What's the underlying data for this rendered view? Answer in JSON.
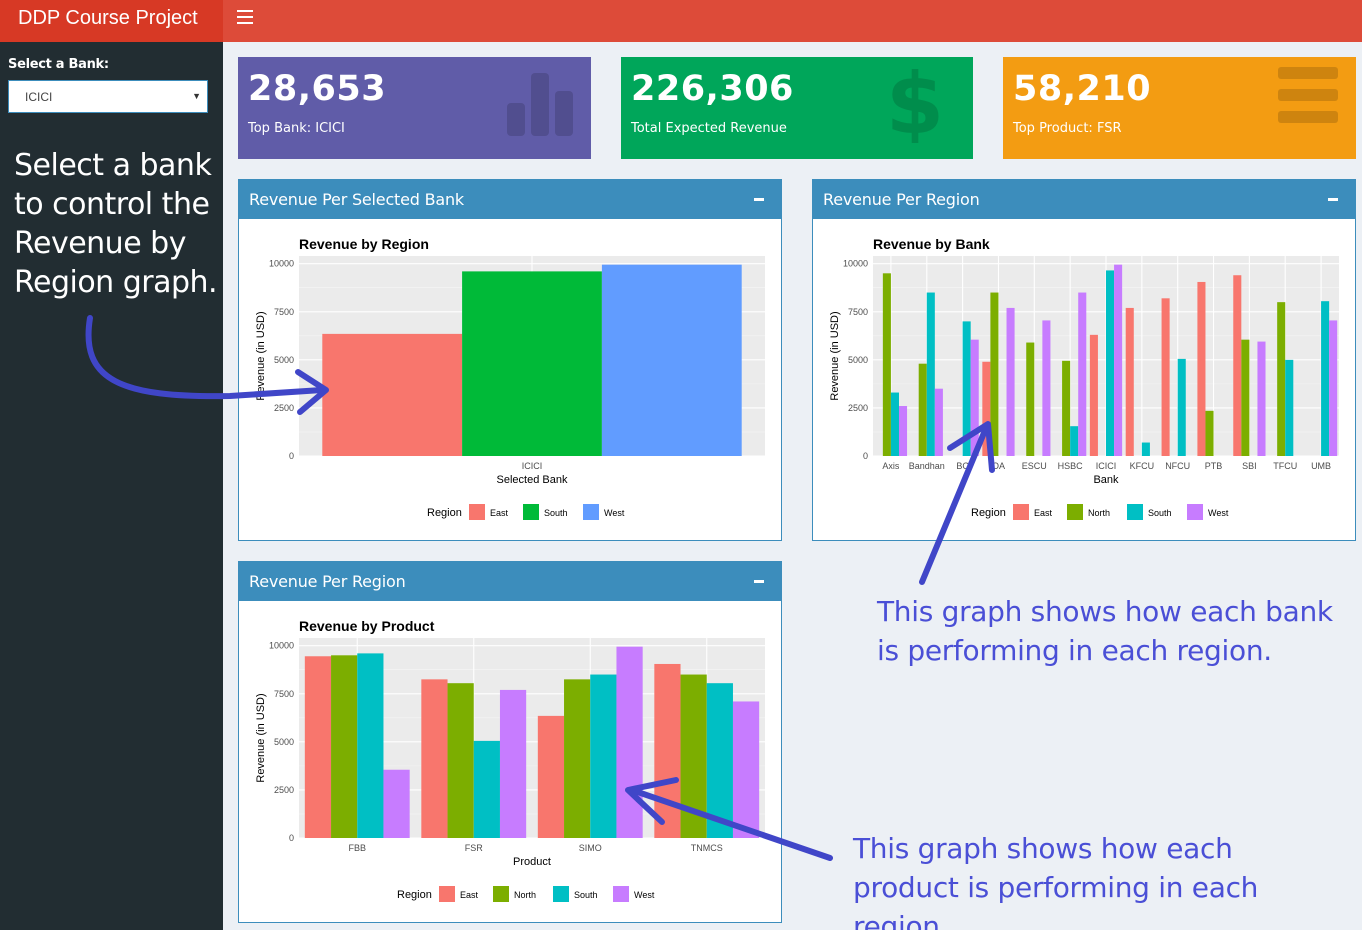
{
  "header": {
    "app_title": "DDP Course Project",
    "menu_icon": "hamburger-icon"
  },
  "sidebar": {
    "select_label": "Select a Bank:",
    "selected_bank": "ICICI",
    "note": "Select a bank to control the Revenue by Region graph."
  },
  "value_boxes": [
    {
      "value": "28,653",
      "label": "Top Bank: ICICI",
      "icon": "bar-chart-icon",
      "color": "#605ca8"
    },
    {
      "value": "226,306",
      "label": "Total Expected Revenue",
      "icon": "dollar-icon",
      "color": "#00a65a"
    },
    {
      "value": "58,210",
      "label": "Top Product: FSR",
      "icon": "list-icon",
      "color": "#f39c12"
    }
  ],
  "boxes": {
    "selected_bank": {
      "title": "Revenue Per Selected Bank"
    },
    "per_region": {
      "title": "Revenue Per Region"
    },
    "per_product": {
      "title": "Revenue Per Region"
    }
  },
  "annotations": {
    "bank_graph": "This graph shows how each bank is performing in each region.",
    "product_graph": "This graph shows how each product is performing in each region."
  },
  "colors": {
    "East": "#f8766d",
    "North": "#7cae00",
    "South": "#00bfc4",
    "West": "#c77cff",
    "East3": "#f8766d",
    "South3": "#00ba38",
    "West3": "#619cff",
    "annotation": "#4a4fd6"
  },
  "chart_data": [
    {
      "type": "bar",
      "title": "Revenue by Region",
      "xlabel": "Selected Bank",
      "ylabel": "Revenue (in USD)",
      "ylim": [
        0,
        10400
      ],
      "yticks": [
        0,
        2500,
        5000,
        7500,
        10000
      ],
      "categories": [
        "ICICI"
      ],
      "legend_title": "Region",
      "legend_position": "bottom",
      "series": [
        {
          "name": "East",
          "values": [
            6350
          ]
        },
        {
          "name": "South",
          "values": [
            9600
          ]
        },
        {
          "name": "West",
          "values": [
            9950
          ]
        }
      ]
    },
    {
      "type": "bar",
      "title": "Revenue by Bank",
      "xlabel": "Bank",
      "ylabel": "Revenue (in USD)",
      "ylim": [
        0,
        10400
      ],
      "yticks": [
        0,
        2500,
        5000,
        7500,
        10000
      ],
      "categories": [
        "Axis",
        "Bandhan",
        "BOA",
        "CBOA",
        "ESCU",
        "HSBC",
        "ICICI",
        "KFCU",
        "NFCU",
        "PTB",
        "SBI",
        "TFCU",
        "UMB"
      ],
      "category_labels": [
        "Axis",
        "Bandhan",
        "BC",
        "OA",
        "ESCU",
        "HSBC",
        "ICICI",
        "KFCU",
        "NFCU",
        "PTB",
        "SBI",
        "TFCU",
        "UMB"
      ],
      "legend_title": "Region",
      "legend_position": "bottom",
      "series": [
        {
          "name": "East",
          "values": [
            null,
            null,
            null,
            4900,
            null,
            null,
            6300,
            7700,
            8200,
            9050,
            9400,
            null,
            null
          ]
        },
        {
          "name": "North",
          "values": [
            9500,
            4800,
            null,
            8500,
            5900,
            4950,
            null,
            null,
            null,
            2350,
            6050,
            8000,
            null
          ]
        },
        {
          "name": "South",
          "values": [
            3300,
            8500,
            7000,
            null,
            null,
            1550,
            9650,
            700,
            5050,
            null,
            null,
            5000,
            8050
          ]
        },
        {
          "name": "West",
          "values": [
            2600,
            3500,
            6050,
            7700,
            7050,
            8500,
            9950,
            null,
            null,
            null,
            5950,
            null,
            7050
          ]
        }
      ]
    },
    {
      "type": "bar",
      "title": "Revenue by Product",
      "xlabel": "Product",
      "ylabel": "Revenue (in USD)",
      "ylim": [
        0,
        10400
      ],
      "yticks": [
        0,
        2500,
        5000,
        7500,
        10000
      ],
      "categories": [
        "FBB",
        "FSR",
        "SIMO",
        "TNMCS"
      ],
      "legend_title": "Region",
      "legend_position": "bottom",
      "series": [
        {
          "name": "East",
          "values": [
            9450,
            8250,
            6350,
            9050
          ]
        },
        {
          "name": "North",
          "values": [
            9500,
            8050,
            8250,
            8500
          ]
        },
        {
          "name": "South",
          "values": [
            9600,
            5050,
            8500,
            8050
          ]
        },
        {
          "name": "West",
          "values": [
            3550,
            7700,
            9950,
            7100
          ]
        }
      ]
    }
  ]
}
